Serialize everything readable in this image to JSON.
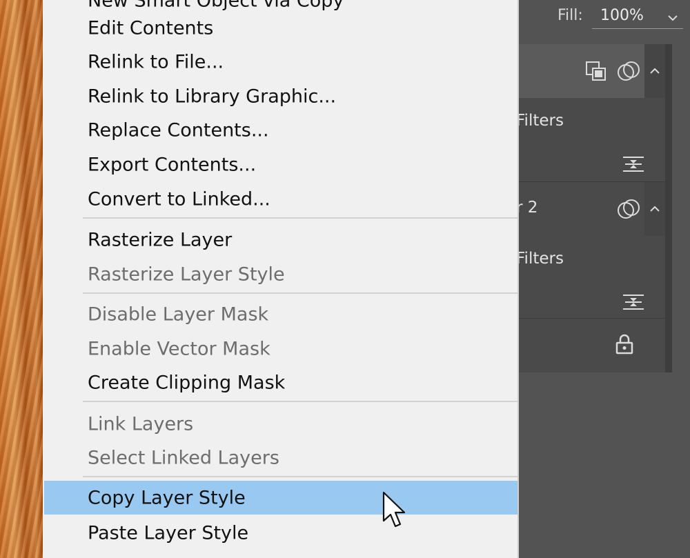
{
  "layers_panel": {
    "fill_label": "Fill:",
    "fill_value": "100%",
    "layer_rows": [
      {
        "name_fragment": "",
        "filters_label": "Filters"
      },
      {
        "name_fragment": "r 2",
        "filters_label": "Filters"
      }
    ]
  },
  "context_menu": {
    "top_partial_item": "New Smart Object via Copy",
    "groups": [
      {
        "items": [
          {
            "label": "Edit Contents",
            "enabled": true
          },
          {
            "label": "Relink to File...",
            "enabled": true
          },
          {
            "label": "Relink to Library Graphic...",
            "enabled": true
          },
          {
            "label": "Replace Contents...",
            "enabled": true
          },
          {
            "label": "Export Contents...",
            "enabled": true
          },
          {
            "label": "Convert to Linked...",
            "enabled": true
          }
        ]
      },
      {
        "items": [
          {
            "label": "Rasterize Layer",
            "enabled": true
          },
          {
            "label": "Rasterize Layer Style",
            "enabled": false
          }
        ]
      },
      {
        "items": [
          {
            "label": "Disable Layer Mask",
            "enabled": false
          },
          {
            "label": "Enable Vector Mask",
            "enabled": false
          },
          {
            "label": "Create Clipping Mask",
            "enabled": true
          }
        ]
      },
      {
        "items": [
          {
            "label": "Link Layers",
            "enabled": false
          },
          {
            "label": "Select Linked Layers",
            "enabled": false
          }
        ]
      },
      {
        "items": [
          {
            "label": "Copy Layer Style",
            "enabled": true,
            "highlighted": true
          },
          {
            "label": "Paste Layer Style",
            "enabled": true
          }
        ]
      }
    ]
  },
  "colors": {
    "menu_background": "#f0f0f0",
    "menu_highlight": "#99c9f0",
    "disabled_text": "#6d6d6d",
    "panel_background": "#535353"
  },
  "icons": [
    "smart-object-icon",
    "filter-effects-icon",
    "filter-options-icon",
    "lock-icon",
    "chevron-down-icon",
    "chevron-up-icon",
    "mouse-pointer-icon"
  ]
}
